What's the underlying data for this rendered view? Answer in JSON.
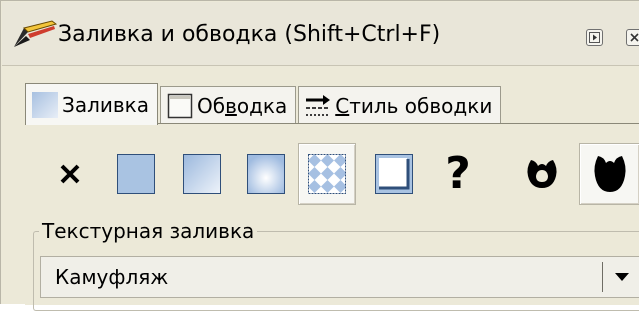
{
  "window": {
    "title": "Заливка и обводка (Shift+Ctrl+F)",
    "icon": "brush-icon",
    "buttons": [
      "pin-icon",
      "close-icon"
    ]
  },
  "tabs": [
    {
      "label_pre": "Заливка",
      "label_u": "",
      "label_post": "",
      "icon": "fill-tab-icon",
      "active": true
    },
    {
      "label_pre": "Об",
      "label_u": "в",
      "label_post": "одка",
      "icon": "stroke-paint-tab-icon",
      "active": false
    },
    {
      "label_pre": "",
      "label_u": "С",
      "label_post": "тиль обводки",
      "icon": "stroke-style-tab-icon",
      "active": false
    }
  ],
  "fill_types": [
    {
      "name": "no-paint",
      "icon": "x-icon"
    },
    {
      "name": "flat-color",
      "icon": "flat-color-icon"
    },
    {
      "name": "linear-gradient",
      "icon": "linear-gradient-icon"
    },
    {
      "name": "radial-gradient",
      "icon": "radial-gradient-icon"
    },
    {
      "name": "pattern",
      "icon": "pattern-icon",
      "selected": true
    },
    {
      "name": "swatch",
      "icon": "swatch-icon"
    },
    {
      "name": "unset",
      "icon": "question-icon",
      "text": "?"
    },
    {
      "name": "fill-rule-evenodd",
      "icon": "evenodd-icon"
    },
    {
      "name": "fill-rule-nonzero",
      "icon": "nonzero-icon",
      "selected": true
    }
  ],
  "pattern_group": {
    "legend": "Текстурная заливка",
    "selected_value": "Камуфляж"
  },
  "colors": {
    "accent": "#2f4f7a",
    "swatch_fill": "#a9c3e2"
  }
}
